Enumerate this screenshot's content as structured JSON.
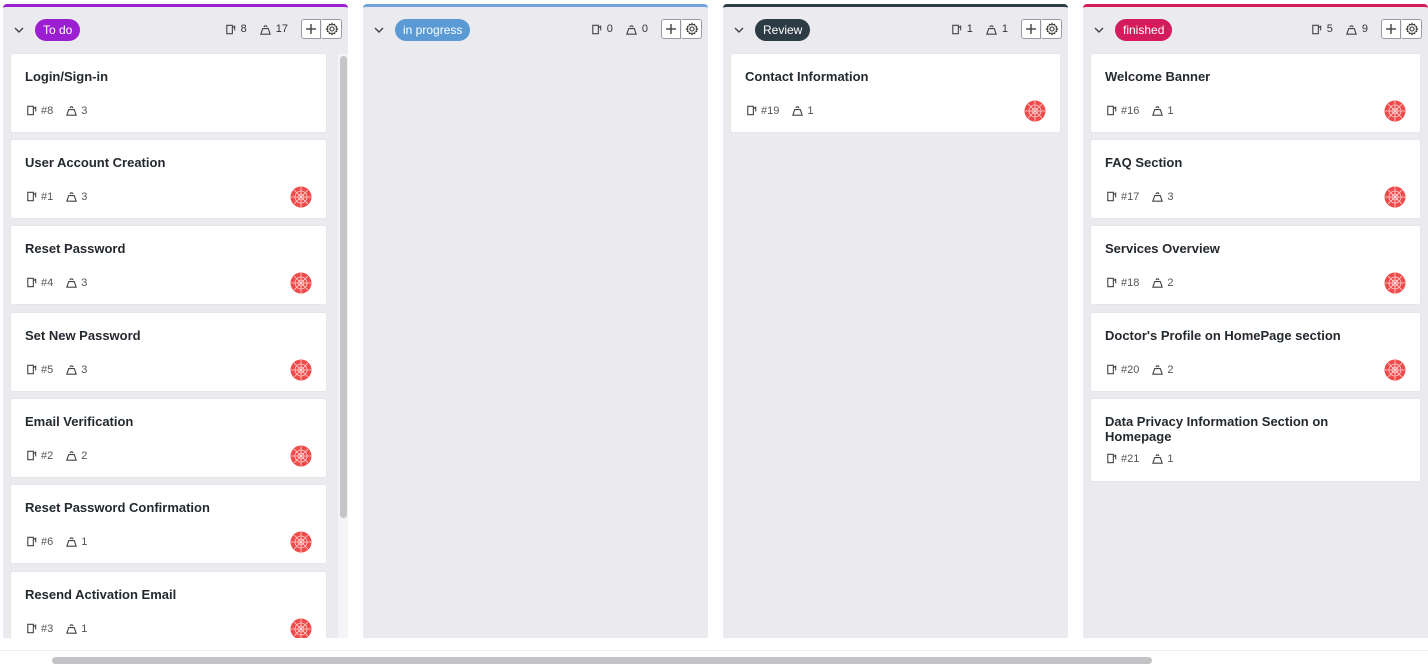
{
  "columns": [
    {
      "name": "To do",
      "badge_color": "#9b1fd1",
      "accent_color": "#9b1fd1",
      "issues_count": "8",
      "points_count": "17",
      "cards": [
        {
          "title": "Login/Sign-in",
          "number": "#8",
          "points": "3",
          "has_avatar": false
        },
        {
          "title": "User Account Creation",
          "number": "#1",
          "points": "3",
          "has_avatar": true
        },
        {
          "title": "Reset Password",
          "number": "#4",
          "points": "3",
          "has_avatar": true
        },
        {
          "title": "Set New Password",
          "number": "#5",
          "points": "3",
          "has_avatar": true
        },
        {
          "title": "Email Verification",
          "number": "#2",
          "points": "2",
          "has_avatar": true
        },
        {
          "title": "Reset Password Confirmation",
          "number": "#6",
          "points": "1",
          "has_avatar": true
        },
        {
          "title": "Resend Activation Email",
          "number": "#3",
          "points": "1",
          "has_avatar": true
        }
      ]
    },
    {
      "name": "in progress",
      "badge_color": "#5b9bd5",
      "accent_color": "#6fa3d9",
      "issues_count": "0",
      "points_count": "0",
      "cards": []
    },
    {
      "name": "Review",
      "badge_color": "#2d3b44",
      "accent_color": "#2d3b44",
      "issues_count": "1",
      "points_count": "1",
      "cards": [
        {
          "title": "Contact Information",
          "number": "#19",
          "points": "1",
          "has_avatar": true
        }
      ]
    },
    {
      "name": "finished",
      "badge_color": "#d41c5c",
      "accent_color": "#d41c5c",
      "issues_count": "5",
      "points_count": "9",
      "cards": [
        {
          "title": "Welcome Banner",
          "number": "#16",
          "points": "1",
          "has_avatar": true
        },
        {
          "title": "FAQ Section",
          "number": "#17",
          "points": "3",
          "has_avatar": true
        },
        {
          "title": "Services Overview",
          "number": "#18",
          "points": "2",
          "has_avatar": true
        },
        {
          "title": "Doctor's Profile on HomePage section",
          "number": "#20",
          "points": "2",
          "has_avatar": true
        },
        {
          "title": "Data Privacy Information Section on Homepage",
          "number": "#21",
          "points": "1",
          "has_avatar": false
        }
      ]
    }
  ],
  "icons": {
    "collapse": "chevron-down-icon",
    "issue": "issue-icon",
    "points": "weight-icon",
    "add": "plus-icon",
    "settings": "gear-icon",
    "avatar": "avatar-icon"
  },
  "colors": {
    "column_bg": "#ebebef",
    "avatar": "#f04b4b"
  }
}
